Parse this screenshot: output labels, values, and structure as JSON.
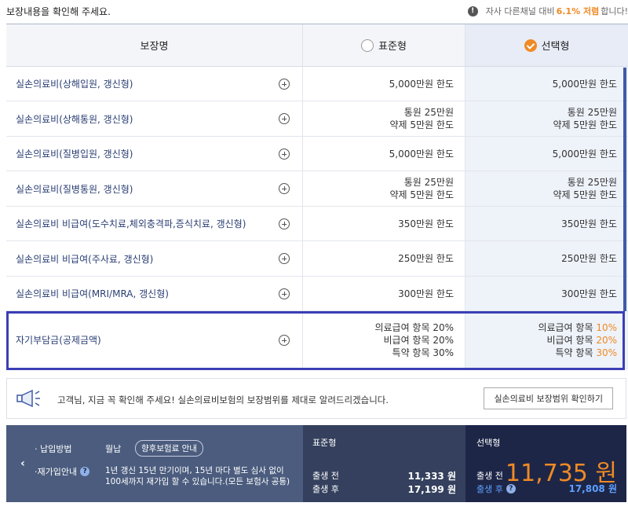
{
  "header": {
    "title": "보장내용을 확인해 주세요.",
    "note_prefix": "자사 다른채널 대비",
    "note_highlight": "6.1% 저렴",
    "note_suffix": "합니다!"
  },
  "table": {
    "col_coverage": "보장명",
    "col_standard": "표준형",
    "col_select": "선택형",
    "rows": [
      {
        "name": "실손의료비(상해입원, 갱신형)",
        "std": [
          "5,000만원 한도"
        ],
        "sel": [
          "5,000만원 한도"
        ]
      },
      {
        "name": "실손의료비(상해통원, 갱신형)",
        "std": [
          "통원 25만원",
          "약제 5만원 한도"
        ],
        "sel": [
          "통원 25만원",
          "약제 5만원 한도"
        ]
      },
      {
        "name": "실손의료비(질병입원, 갱신형)",
        "std": [
          "5,000만원 한도"
        ],
        "sel": [
          "5,000만원 한도"
        ]
      },
      {
        "name": "실손의료비(질병통원, 갱신형)",
        "std": [
          "통원 25만원",
          "약제 5만원 한도"
        ],
        "sel": [
          "통원 25만원",
          "약제 5만원 한도"
        ]
      },
      {
        "name": "실손의료비 비급여(도수치료,체외충격파,증식치료, 갱신형)",
        "std": [
          "350만원 한도"
        ],
        "sel": [
          "350만원 한도"
        ]
      },
      {
        "name": "실손의료비 비급여(주사료, 갱신형)",
        "std": [
          "250만원 한도"
        ],
        "sel": [
          "250만원 한도"
        ]
      },
      {
        "name": "실손의료비 비급여(MRI/MRA, 갱신형)",
        "std": [
          "300만원 한도"
        ],
        "sel": [
          "300만원 한도"
        ]
      }
    ],
    "deductible": {
      "name": "자기부담금(공제금액)",
      "std": [
        "의료급여 항목 20%",
        "비급여 항목 20%",
        "특약 항목 30%"
      ],
      "sel": [
        {
          "label": "의료급여 항목",
          "value": "10%"
        },
        {
          "label": "비급여 항목",
          "value": "20%"
        },
        {
          "label": "특약 항목",
          "value": "30%"
        }
      ]
    }
  },
  "notice": {
    "text": "고객님, 지금 꼭 확인해 주세요! 실손의료비보험의 보장범위를 제대로 알려드리겠습니다.",
    "button": "실손의료비 보장범위 확인하기"
  },
  "summary": {
    "payment_label": "납입방법",
    "payment_value": "월납",
    "future_link": "향후보험료 안내",
    "renew_label": "재가입안내",
    "renew_desc1": "1년 갱신 15년 만기이며, 15년 마다 별도 심사 없이",
    "renew_desc2": "100세까지 재가입 할 수 있습니다.(모든 보험사 공통)",
    "standard": {
      "title": "표준형",
      "before_label": "출생 전",
      "before_value": "11,333 원",
      "after_label": "출생 후",
      "after_value": "17,199 원"
    },
    "select": {
      "title": "선택형",
      "before_label": "출생 전",
      "before_value": "11,735 원",
      "after_label": "출생 후",
      "after_value": "17,808 원"
    }
  },
  "colors": {
    "accent": "#f08a24",
    "highlight_border": "#3b3fb5",
    "coverage_text": "#2a3e73"
  }
}
